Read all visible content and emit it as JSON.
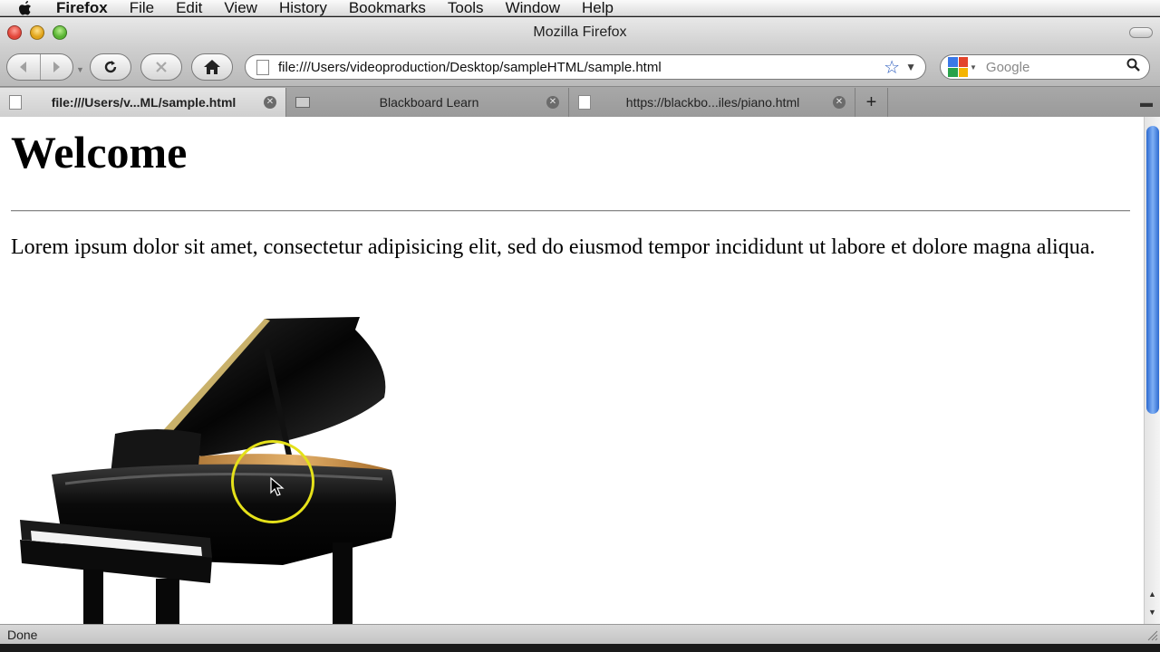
{
  "menubar": {
    "apple_icon": "apple-icon",
    "app": "Firefox",
    "items": [
      "File",
      "Edit",
      "View",
      "History",
      "Bookmarks",
      "Tools",
      "Window",
      "Help"
    ]
  },
  "window": {
    "title": "Mozilla Firefox"
  },
  "toolbar": {
    "url": "file:///Users/videoproduction/Desktop/sampleHTML/sample.html",
    "search_placeholder": "Google"
  },
  "tabs": [
    {
      "label": "file:///Users/v...ML/sample.html",
      "active": true
    },
    {
      "label": "Blackboard Learn",
      "active": false
    },
    {
      "label": "https://blackbo...iles/piano.html",
      "active": false
    }
  ],
  "page": {
    "heading": "Welcome",
    "paragraph": "Lorem ipsum dolor sit amet, consectetur adipisicing elit, sed do eiusmod tempor incididunt ut labore et dolore magna aliqua."
  },
  "status": {
    "text": "Done"
  },
  "colors": {
    "scroll_thumb": "#3d7be0",
    "cursor_highlight": "#e5e11a"
  }
}
